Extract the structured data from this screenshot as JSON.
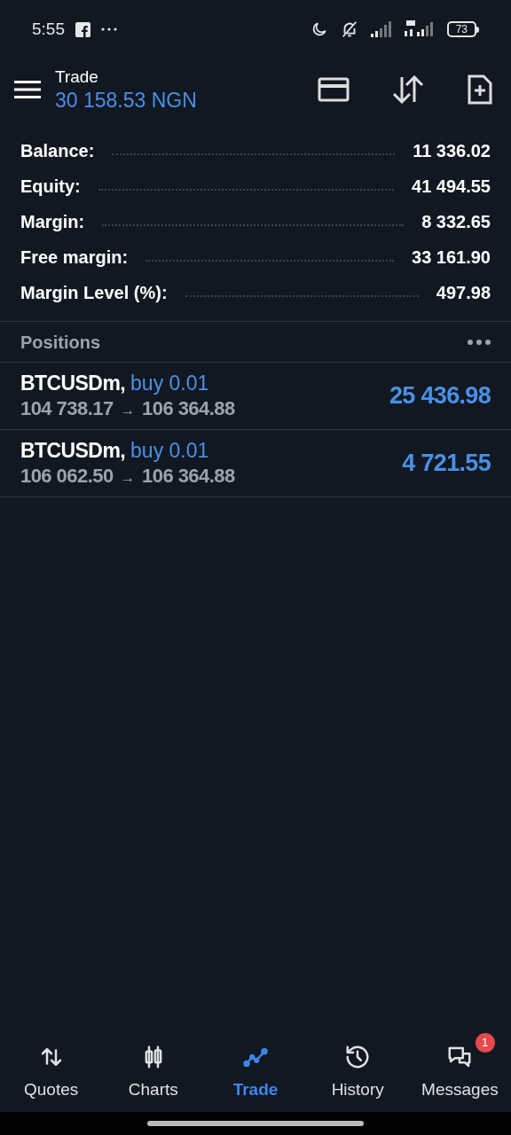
{
  "status_bar": {
    "time": "5:55",
    "battery": "73"
  },
  "header": {
    "title": "Trade",
    "balance": "30 158.53 NGN"
  },
  "summary": [
    {
      "label": "Balance:",
      "value": "11 336.02"
    },
    {
      "label": "Equity:",
      "value": "41 494.55"
    },
    {
      "label": "Margin:",
      "value": "8 332.65"
    },
    {
      "label": "Free margin:",
      "value": "33 161.90"
    },
    {
      "label": "Margin Level (%):",
      "value": "497.98"
    }
  ],
  "positions": {
    "title": "Positions",
    "rows": [
      {
        "symbol": "BTCUSDm,",
        "side": "buy 0.01",
        "open_price": "104 738.17",
        "arrow": "→",
        "current_price": "106 364.88",
        "profit": "25 436.98"
      },
      {
        "symbol": "BTCUSDm,",
        "side": "buy 0.01",
        "open_price": "106 062.50",
        "arrow": "→",
        "current_price": "106 364.88",
        "profit": "4 721.55"
      }
    ]
  },
  "nav": [
    {
      "kind": "quotes",
      "label": "Quotes",
      "selected": false
    },
    {
      "kind": "charts",
      "label": "Charts",
      "selected": false
    },
    {
      "kind": "trade",
      "label": "Trade",
      "selected": true
    },
    {
      "kind": "history",
      "label": "History",
      "selected": false
    },
    {
      "kind": "messages",
      "label": "Messages",
      "selected": false,
      "badge": "1"
    }
  ]
}
